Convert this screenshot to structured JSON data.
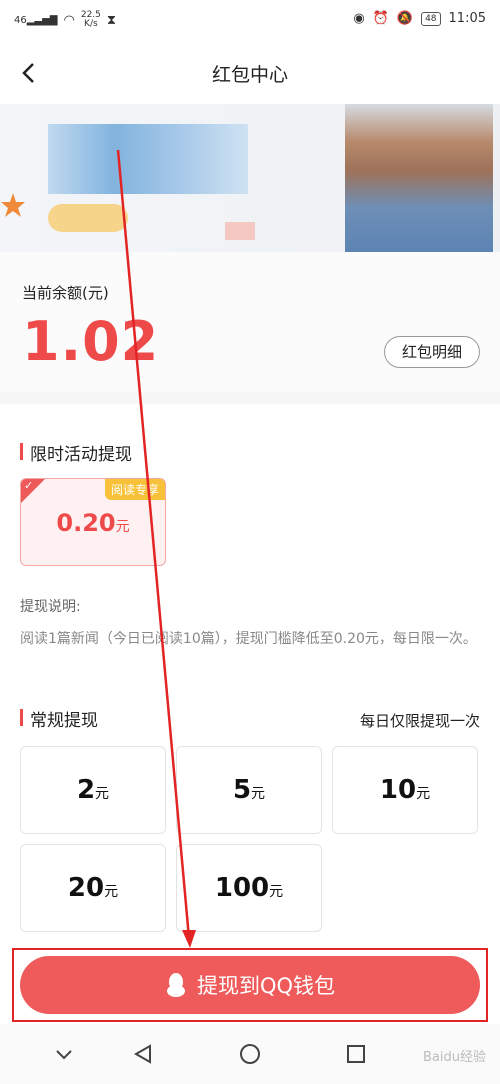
{
  "status_bar": {
    "signal": "46",
    "net_speed_value": "22.5",
    "net_speed_unit": "K/s",
    "battery": "48",
    "time": "11:05"
  },
  "nav": {
    "title": "红包中心"
  },
  "balance": {
    "label": "当前余额(元)",
    "value": "1.02",
    "detail_button": "红包明细"
  },
  "promo_section": {
    "title": "限时活动提现",
    "card": {
      "tag": "阅读专享",
      "amount": "0.20",
      "unit": "元"
    },
    "desc_title": "提现说明:",
    "desc_text": "阅读1篇新闻（今日已阅读10篇），提现门槛降低至0.20元，每日限一次。"
  },
  "regular_section": {
    "title": "常规提现",
    "note": "每日仅限提现一次",
    "options": [
      {
        "amount": "2",
        "unit": "元"
      },
      {
        "amount": "5",
        "unit": "元"
      },
      {
        "amount": "10",
        "unit": "元"
      },
      {
        "amount": "20",
        "unit": "元"
      },
      {
        "amount": "100",
        "unit": "元"
      }
    ]
  },
  "cta": {
    "label": "提现到QQ钱包"
  },
  "watermark": "Baidu经验",
  "colors": {
    "accent": "#ee4a4a",
    "button": "#ef5b5b",
    "annotation": "#e22424",
    "tag": "#f7c23a"
  }
}
